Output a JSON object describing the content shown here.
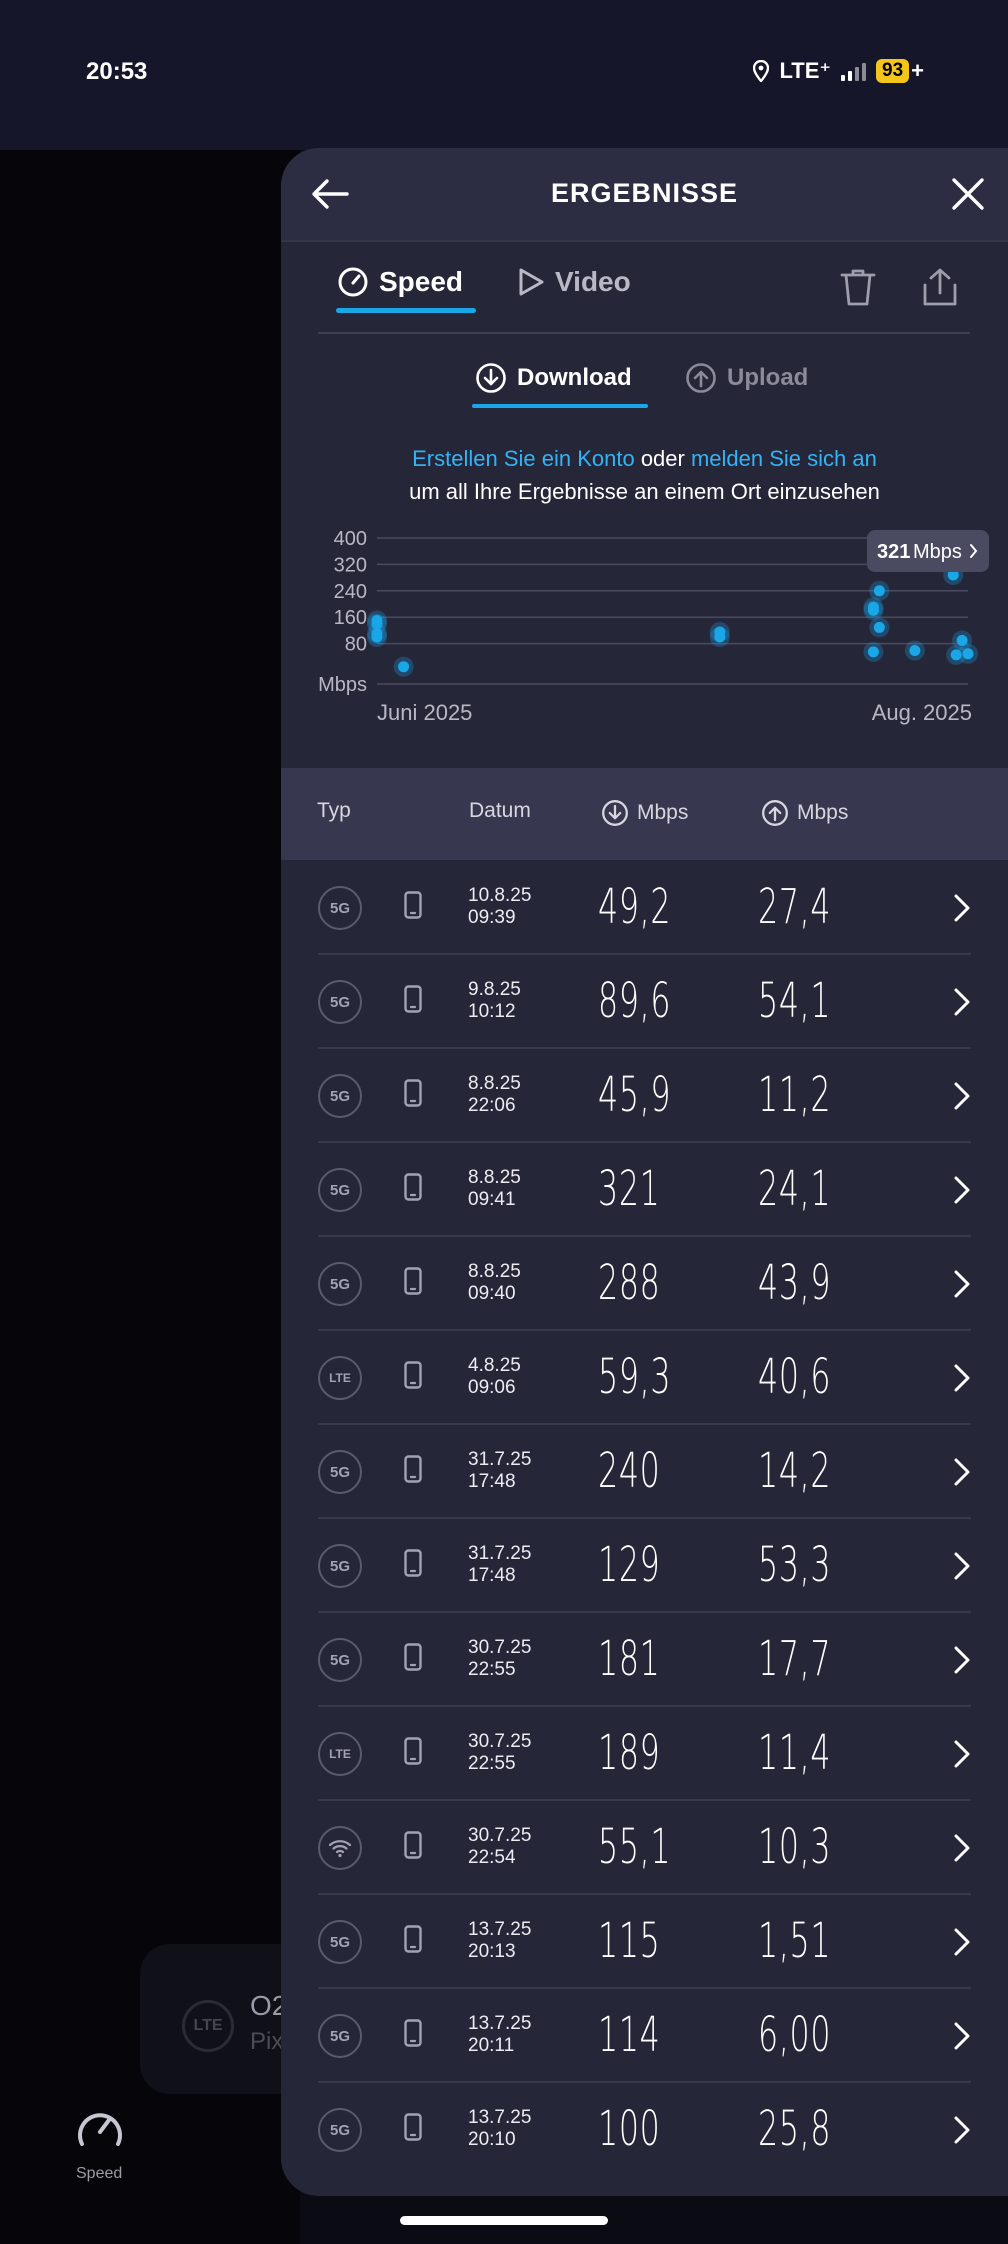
{
  "status": {
    "time": "20:53",
    "network": "LTE⁺",
    "battery": "93"
  },
  "background": {
    "card_badge": "LTE",
    "card_title": "O2",
    "card_sub": "Pix",
    "nav_label": "Speed"
  },
  "header": {
    "title": "ERGEBNISSE",
    "back_icon": "arrow-left-icon",
    "close_icon": "close-icon"
  },
  "tabs": [
    {
      "label": "Speed",
      "icon": "gauge-icon",
      "active": true
    },
    {
      "label": "Video",
      "icon": "play-icon",
      "active": false
    }
  ],
  "subtabs": [
    {
      "label": "Download",
      "icon": "download-circle-icon",
      "active": true
    },
    {
      "label": "Upload",
      "icon": "upload-circle-icon",
      "active": false
    }
  ],
  "promo": {
    "link1": "Erstellen Sie ein Konto",
    "mid": " oder ",
    "link2": "melden Sie sich an",
    "line2": "um all Ihre Ergebnisse an einem Ort einzusehen"
  },
  "chart_data": {
    "type": "scatter",
    "ylabel": "Mbps",
    "yticks": [
      400,
      320,
      240,
      160,
      80
    ],
    "ylim": [
      0,
      400
    ],
    "xlabels": [
      "Juni 2025",
      "Aug. 2025"
    ],
    "xlim": [
      0,
      100
    ],
    "tooltip": {
      "value": "321",
      "unit": "Mbps"
    },
    "points": [
      {
        "x": 0,
        "y": 150
      },
      {
        "x": 0,
        "y": 140
      },
      {
        "x": 0,
        "y": 110
      },
      {
        "x": 0,
        "y": 100
      },
      {
        "x": 4.5,
        "y": 10
      },
      {
        "x": 58,
        "y": 115
      },
      {
        "x": 58,
        "y": 100
      },
      {
        "x": 84,
        "y": 190
      },
      {
        "x": 84,
        "y": 181
      },
      {
        "x": 85,
        "y": 240
      },
      {
        "x": 85,
        "y": 129
      },
      {
        "x": 84,
        "y": 55
      },
      {
        "x": 91,
        "y": 59
      },
      {
        "x": 97.5,
        "y": 321
      },
      {
        "x": 97.5,
        "y": 288
      },
      {
        "x": 98,
        "y": 45.9
      },
      {
        "x": 99,
        "y": 89.6
      },
      {
        "x": 100,
        "y": 49.2
      }
    ]
  },
  "table": {
    "headers": {
      "type": "Typ",
      "date": "Datum",
      "dl": "Mbps",
      "ul": "Mbps"
    },
    "rows": [
      {
        "type": "5G",
        "date": "10.8.25",
        "time": "09:39",
        "dl": "49,2",
        "ul": "27,4"
      },
      {
        "type": "5G",
        "date": "9.8.25",
        "time": "10:12",
        "dl": "89,6",
        "ul": "54,1"
      },
      {
        "type": "5G",
        "date": "8.8.25",
        "time": "22:06",
        "dl": "45,9",
        "ul": "11,2"
      },
      {
        "type": "5G",
        "date": "8.8.25",
        "time": "09:41",
        "dl": "321",
        "ul": "24,1"
      },
      {
        "type": "5G",
        "date": "8.8.25",
        "time": "09:40",
        "dl": "288",
        "ul": "43,9"
      },
      {
        "type": "LTE",
        "date": "4.8.25",
        "time": "09:06",
        "dl": "59,3",
        "ul": "40,6"
      },
      {
        "type": "5G",
        "date": "31.7.25",
        "time": "17:48",
        "dl": "240",
        "ul": "14,2"
      },
      {
        "type": "5G",
        "date": "31.7.25",
        "time": "17:48",
        "dl": "129",
        "ul": "53,3"
      },
      {
        "type": "5G",
        "date": "30.7.25",
        "time": "22:55",
        "dl": "181",
        "ul": "17,7"
      },
      {
        "type": "LTE",
        "date": "30.7.25",
        "time": "22:55",
        "dl": "189",
        "ul": "11,4"
      },
      {
        "type": "WIFI",
        "date": "30.7.25",
        "time": "22:54",
        "dl": "55,1",
        "ul": "10,3"
      },
      {
        "type": "5G",
        "date": "13.7.25",
        "time": "20:13",
        "dl": "115",
        "ul": "1,51"
      },
      {
        "type": "5G",
        "date": "13.7.25",
        "time": "20:11",
        "dl": "114",
        "ul": "6,00"
      },
      {
        "type": "5G",
        "date": "13.7.25",
        "time": "20:10",
        "dl": "100",
        "ul": "25,8"
      }
    ]
  },
  "colors": {
    "accent": "#1aa7e8",
    "panel": "#262639",
    "point": "#1aa7e8"
  }
}
